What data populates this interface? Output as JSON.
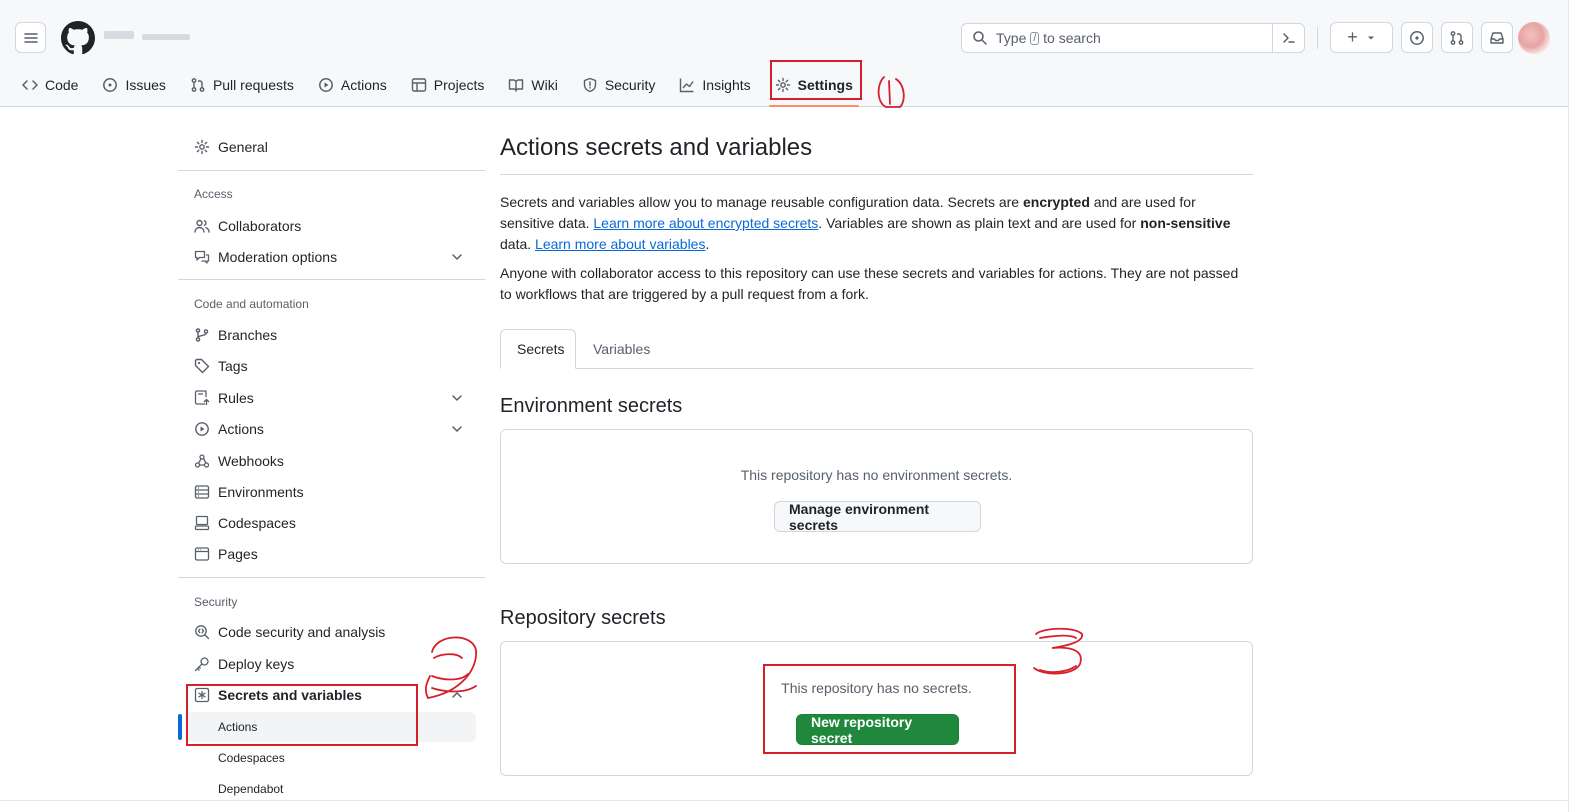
{
  "header": {
    "search_prefix": "Type",
    "search_kbd": "/",
    "search_suffix": "to search",
    "plus_label": "+"
  },
  "nav": {
    "items": [
      {
        "label": "Code",
        "icon": "code-icon"
      },
      {
        "label": "Issues",
        "icon": "issue-icon"
      },
      {
        "label": "Pull requests",
        "icon": "pull-request-icon"
      },
      {
        "label": "Actions",
        "icon": "play-icon"
      },
      {
        "label": "Projects",
        "icon": "table-icon"
      },
      {
        "label": "Wiki",
        "icon": "book-icon"
      },
      {
        "label": "Security",
        "icon": "shield-icon"
      },
      {
        "label": "Insights",
        "icon": "graph-icon"
      },
      {
        "label": "Settings",
        "icon": "gear-icon"
      }
    ]
  },
  "sidebar": {
    "general": "General",
    "access_heading": "Access",
    "collaborators": "Collaborators",
    "moderation": "Moderation options",
    "code_heading": "Code and automation",
    "branches": "Branches",
    "tags": "Tags",
    "rules": "Rules",
    "actions": "Actions",
    "webhooks": "Webhooks",
    "environments": "Environments",
    "codespaces": "Codespaces",
    "pages": "Pages",
    "security_heading": "Security",
    "code_security": "Code security and analysis",
    "deploy_keys": "Deploy keys",
    "secrets_vars": "Secrets and variables",
    "sub_actions": "Actions",
    "sub_codespaces": "Codespaces",
    "sub_dependabot": "Dependabot"
  },
  "main": {
    "title": "Actions secrets and variables",
    "p1_a": "Secrets and variables allow you to manage reusable configuration data. Secrets are ",
    "p1_b": "encrypted",
    "p1_c": " and are used for sensitive data. ",
    "p1_link1": "Learn more about encrypted secrets",
    "p1_d": ". Variables are shown as plain text and are used for ",
    "p1_e": "non-sensitive",
    "p1_f": " data. ",
    "p1_link2": "Learn more about variables",
    "p1_g": ".",
    "p2": "Anyone with collaborator access to this repository can use these secrets and variables for actions. They are not passed to workflows that are triggered by a pull request from a fork.",
    "tab_secrets": "Secrets",
    "tab_variables": "Variables",
    "env_heading": "Environment secrets",
    "env_empty": "This repository has no environment secrets.",
    "env_button": "Manage environment secrets",
    "repo_heading": "Repository secrets",
    "repo_empty": "This repository has no secrets.",
    "repo_button": "New repository secret"
  },
  "annotations": {
    "color": "#d5202b",
    "marks": [
      "1",
      "2",
      "3"
    ]
  }
}
